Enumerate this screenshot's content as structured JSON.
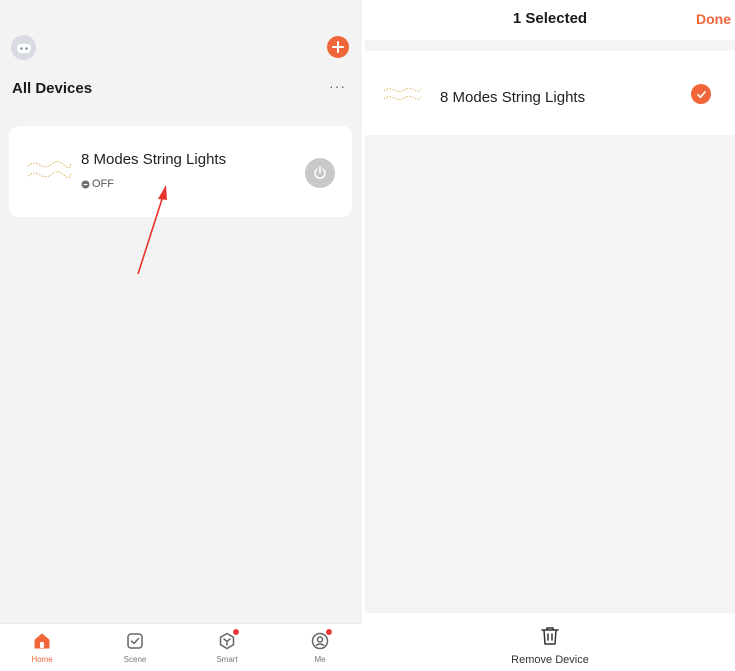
{
  "home": {
    "title": "All Devices",
    "more_label": "···",
    "device": {
      "name": "8 Modes String Lights",
      "status": "OFF"
    },
    "tabs": [
      {
        "label": "Home",
        "icon": "home-icon",
        "active": true
      },
      {
        "label": "Scene",
        "icon": "scene-icon",
        "active": false
      },
      {
        "label": "Smart",
        "icon": "smart-icon",
        "active": false
      },
      {
        "label": "Me",
        "icon": "me-icon",
        "active": false
      }
    ]
  },
  "edit": {
    "title": "1 Selected",
    "done_label": "Done",
    "selected_device": {
      "name": "8 Modes String Lights",
      "checked": true
    },
    "remove_label": "Remove Device"
  },
  "colors": {
    "accent": "#f0663a",
    "badge": "#f03a3a",
    "off_gray": "#c8c8c8"
  }
}
